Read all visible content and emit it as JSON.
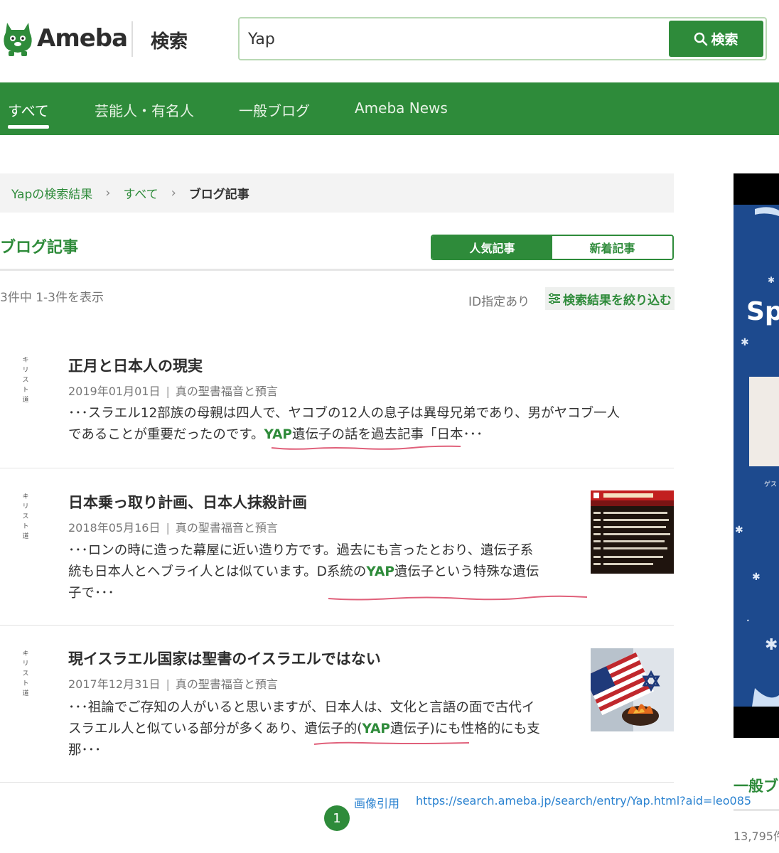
{
  "header": {
    "logo_text": "Ameba",
    "search_label": "検索",
    "search_value": "Yap",
    "search_button": "検索"
  },
  "nav": {
    "tabs": [
      {
        "label": "すべて",
        "active": true
      },
      {
        "label": "芸能人・有名人",
        "active": false
      },
      {
        "label": "一般ブログ",
        "active": false
      },
      {
        "label": "Ameba News",
        "active": false
      }
    ]
  },
  "breadcrumb": {
    "items": [
      "Yapの検索結果",
      "すべて",
      "ブログ記事"
    ]
  },
  "section": {
    "title": "ブログ記事",
    "sort_popular": "人気記事",
    "sort_new": "新着記事",
    "result_count": "3件中 1-3件を表示",
    "id_filter": "ID指定あり",
    "refine_button": "検索結果を絞り込む"
  },
  "entries": [
    {
      "blog_icon_text": "キリスト道",
      "title": "正月と日本人の現実",
      "date": "2019年01月01日",
      "category": "真の聖書福音と預言",
      "snippet_line1": "･･･スラエル12部族の母親は四人で、ヤコブの12人の息子は異母兄弟であり、男がヤコブ一人",
      "snippet_line2_pre": "であることが重要だったのです。",
      "snippet_line2_hl": "YAP",
      "snippet_line2_post": "遺伝子の話を過去記事「日本･･･"
    },
    {
      "blog_icon_text": "キリスト道",
      "title": "日本乗っ取り計画、日本人抹殺計画",
      "date": "2018年05月16日",
      "category": "真の聖書福音と預言",
      "snippet_line1": "･･･ロンの時に造った幕屋に近い造り方です。過去にも言ったとおり、遺伝子系",
      "snippet_line2_pre": "統も日本人とヘブライ人とは似ています。D系統の",
      "snippet_line2_hl": "YAP",
      "snippet_line2_post": "遺伝子という特殊な遺伝",
      "snippet_line3": "子で･･･"
    },
    {
      "blog_icon_text": "キリスト道",
      "title": "現イスラエル国家は聖書のイスラエルではない",
      "date": "2017年12月31日",
      "category": "真の聖書福音と預言",
      "snippet_line1": "･･･祖論でご存知の人がいると思いますが、日本人は、文化と言語の面で古代イ",
      "snippet_line2_pre": "スラエル人と似ている部分が多くあり、遺伝子的(",
      "snippet_line2_hl": "YAP",
      "snippet_line2_post": "遺伝子)にも性格的にも支",
      "snippet_line3": "那･･･"
    }
  ],
  "footer": {
    "source_label": "画像引用",
    "source_url": "https://search.ameba.jp/search/entry/Yap.html?aid=leo085",
    "page_number": "1"
  },
  "sidebar": {
    "ad_text": "Sp",
    "ad_sub": "ゲス",
    "heading": "一般ブ",
    "count": "13,795件"
  },
  "colors": {
    "brand_green": "#2e8b3a",
    "annotation_red": "#e0607a",
    "link_blue": "#2a82d0"
  }
}
